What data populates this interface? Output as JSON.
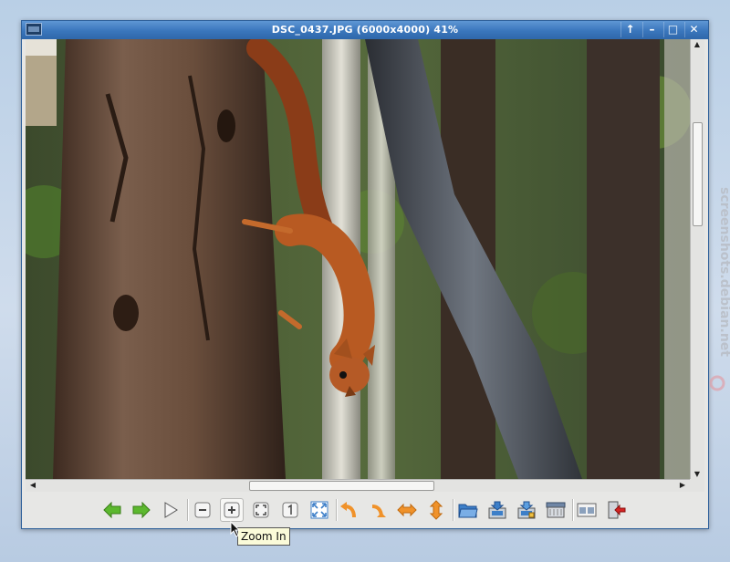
{
  "window": {
    "title": "DSC_0437.JPG (6000x4000) 41%",
    "app_icon": "image-viewer-icon",
    "controls": {
      "raise": "↑",
      "minimize": "–",
      "maximize": "□",
      "close": "✕"
    }
  },
  "image": {
    "description_icon": "photo-squirrel-on-tree"
  },
  "scrollbars": {
    "vertical": {
      "up": "▲",
      "down": "▼",
      "position": 0.17,
      "size": 0.25
    },
    "horizontal": {
      "left": "◀",
      "right": "▶",
      "position": 0.33,
      "size": 0.29
    }
  },
  "toolbar": {
    "buttons": [
      {
        "name": "previous-image-button",
        "icon": "arrow-left-icon"
      },
      {
        "name": "next-image-button",
        "icon": "arrow-right-icon"
      },
      {
        "name": "slideshow-button",
        "icon": "play-icon"
      },
      {
        "name": "zoom-out-button",
        "icon": "zoom-out-icon"
      },
      {
        "name": "zoom-in-button",
        "icon": "zoom-in-icon"
      },
      {
        "name": "zoom-fit-button",
        "icon": "zoom-fit-icon"
      },
      {
        "name": "zoom-original-button",
        "icon": "zoom-100-icon"
      },
      {
        "name": "fullscreen-button",
        "icon": "fullscreen-icon"
      },
      {
        "name": "rotate-left-button",
        "icon": "rotate-left-icon"
      },
      {
        "name": "rotate-right-button",
        "icon": "rotate-right-icon"
      },
      {
        "name": "flip-horizontal-button",
        "icon": "flip-horizontal-icon"
      },
      {
        "name": "flip-vertical-button",
        "icon": "flip-vertical-icon"
      },
      {
        "name": "open-file-button",
        "icon": "folder-open-icon"
      },
      {
        "name": "save-file-button",
        "icon": "save-icon"
      },
      {
        "name": "save-as-button",
        "icon": "save-as-icon"
      },
      {
        "name": "delete-file-button",
        "icon": "trash-icon"
      },
      {
        "name": "preferences-button",
        "icon": "preferences-icon"
      },
      {
        "name": "quit-button",
        "icon": "exit-icon"
      }
    ]
  },
  "tooltip": {
    "text": "Zoom In"
  },
  "watermark": {
    "text": "screenshots.debian.net"
  },
  "colors": {
    "titlebar": "#3a76bc",
    "green_arrow": "#5cb82e",
    "orange_arrow": "#f0922a",
    "folder_blue": "#3d7fc8"
  }
}
